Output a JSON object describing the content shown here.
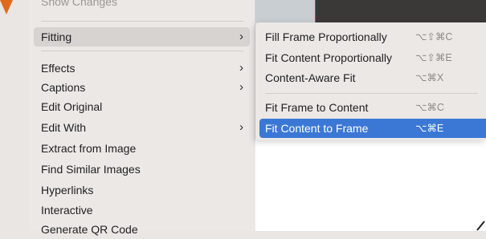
{
  "main_menu": {
    "cut_item": "Show Changes",
    "items": [
      {
        "label": "Fitting",
        "submenu": true,
        "highlighted": true
      },
      {
        "label": "Effects",
        "submenu": true
      },
      {
        "label": "Captions",
        "submenu": true
      },
      {
        "label": "Edit Original",
        "submenu": false
      },
      {
        "label": "Edit With",
        "submenu": true
      },
      {
        "label": "Extract from Image",
        "submenu": false
      },
      {
        "label": "Find Similar Images",
        "submenu": false
      },
      {
        "label": "Hyperlinks",
        "submenu": false
      },
      {
        "label": "Interactive",
        "submenu": false
      },
      {
        "label": "Generate QR Code",
        "submenu": false
      }
    ],
    "chevron_icon": "chevron-right-icon"
  },
  "fitting_submenu": {
    "items": [
      {
        "label": "Fill Frame Proportionally",
        "shortcut": "⌥⇧⌘C"
      },
      {
        "label": "Fit Content Proportionally",
        "shortcut": "⌥⇧⌘E"
      },
      {
        "label": "Content-Aware Fit",
        "shortcut": "⌥⌘X"
      },
      {
        "label": "Fit Frame to Content",
        "shortcut": "⌥⌘C"
      },
      {
        "label": "Fit Content to Frame",
        "shortcut": "⌥⌘E",
        "selected": true
      }
    ]
  },
  "colors": {
    "selection": "#3b78d6",
    "menu_bg": "#ebe8e6",
    "accent_marker": "#e06a1b"
  }
}
